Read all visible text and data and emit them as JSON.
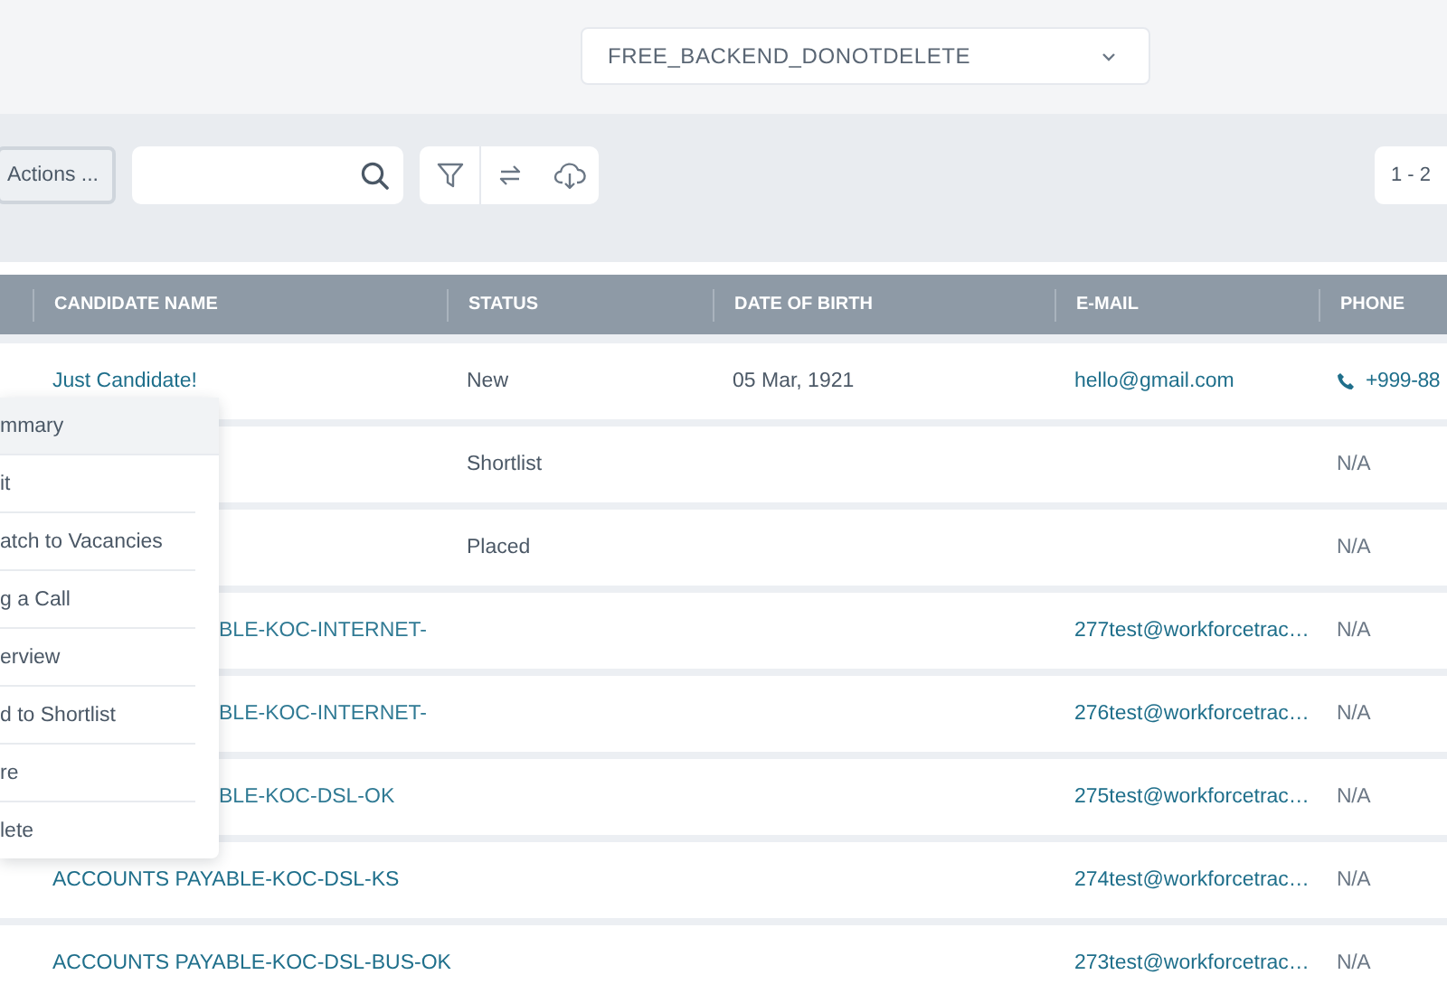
{
  "account_select": {
    "value": "FREE_BACKEND_DONOTDELETE"
  },
  "toolbar": {
    "actions_button": "Actions ...",
    "pagination": "1 - 2"
  },
  "table": {
    "columns": [
      "CANDIDATE NAME",
      "STATUS",
      "DATE OF BIRTH",
      "E-MAIL",
      "PHONE"
    ],
    "rows": [
      {
        "name": "Just Candidate!",
        "clipped": false,
        "status": "New",
        "dob": "05 Mar, 1921",
        "email": "hello@gmail.com",
        "phone": "+999-88",
        "phone_icon": true
      },
      {
        "status": "Shortlist",
        "phone": "N/A",
        "phone_icon": false
      },
      {
        "status": "Placed",
        "phone": "N/A",
        "phone_icon": false
      },
      {
        "name": "BLE-KOC-INTERNET-",
        "clipped": true,
        "email": "277test@workforcetrac…",
        "phone": "N/A",
        "phone_icon": false
      },
      {
        "name": "BLE-KOC-INTERNET-",
        "clipped": true,
        "email": "276test@workforcetrac…",
        "phone": "N/A",
        "phone_icon": false
      },
      {
        "name": "BLE-KOC-DSL-OK",
        "clipped": true,
        "email": "275test@workforcetrac…",
        "phone": "N/A",
        "phone_icon": false
      },
      {
        "name": "ACCOUNTS PAYABLE-KOC-DSL-KS",
        "clipped": false,
        "email": "274test@workforcetrac…",
        "phone": "N/A",
        "phone_icon": false
      },
      {
        "name": "ACCOUNTS PAYABLE-KOC-DSL-BUS-OK",
        "clipped": false,
        "email": "273test@workforcetrac…",
        "phone": "N/A",
        "phone_icon": false
      }
    ]
  },
  "context_menu": {
    "items": [
      {
        "label": "mmary",
        "selected": true
      },
      {
        "label": "it",
        "selected": false
      },
      {
        "label": "atch to Vacancies",
        "selected": false
      },
      {
        "label": "g a Call",
        "selected": false
      },
      {
        "label": "erview",
        "selected": false
      },
      {
        "label": "d to Shortlist",
        "selected": false
      },
      {
        "label": "re",
        "selected": false
      },
      {
        "label": "lete",
        "selected": false
      }
    ]
  }
}
